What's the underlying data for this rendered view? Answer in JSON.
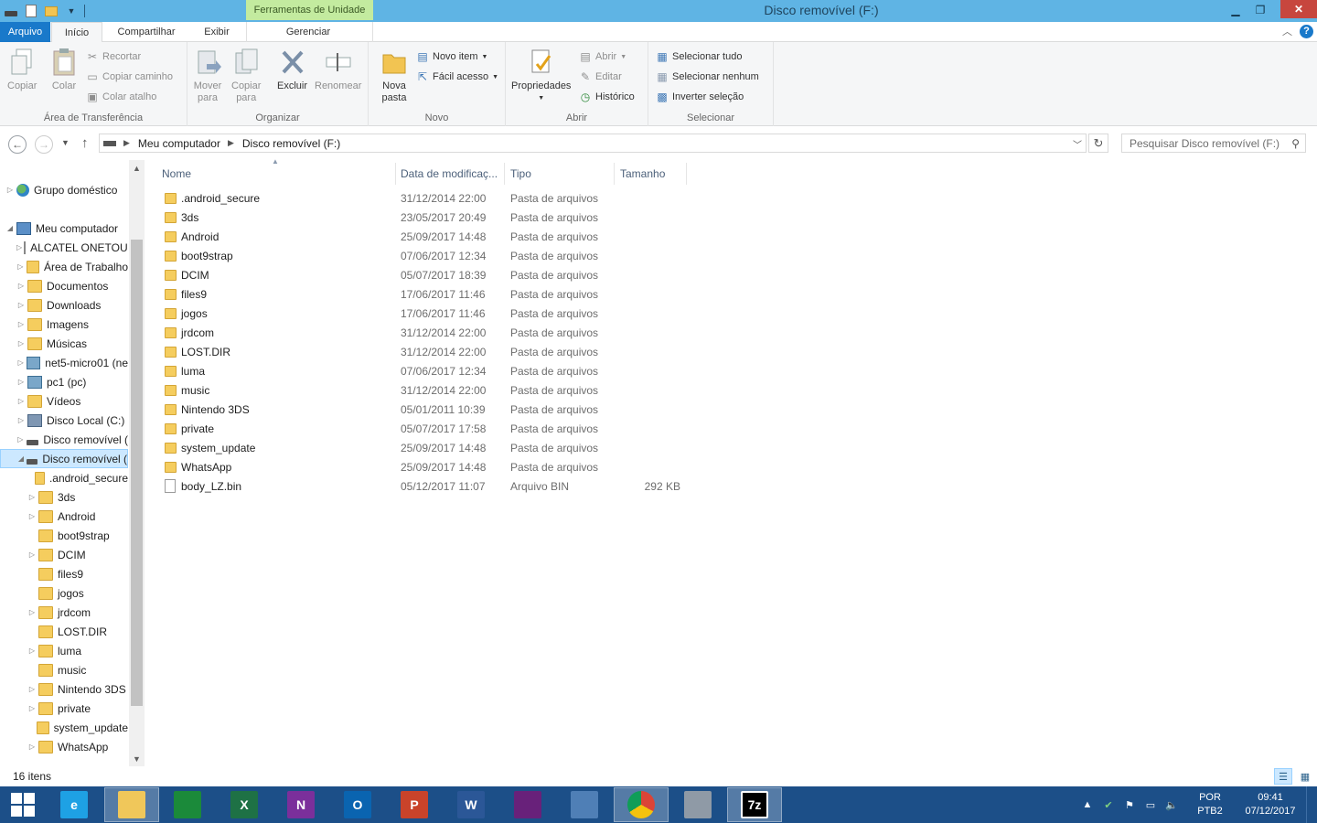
{
  "window": {
    "title": "Disco removível (F:)",
    "context_tab_header": "Ferramentas de Unidade"
  },
  "tabs": {
    "file": "Arquivo",
    "home": "Início",
    "share": "Compartilhar",
    "view": "Exibir",
    "manage": "Gerenciar"
  },
  "ribbon": {
    "clipboard": {
      "label": "Área de Transferência",
      "copy": "Copiar",
      "paste": "Colar",
      "cut": "Recortar",
      "copy_path": "Copiar caminho",
      "paste_shortcut": "Colar atalho"
    },
    "organize": {
      "label": "Organizar",
      "move_to_1": "Mover",
      "move_to_2": "para",
      "copy_to_1": "Copiar",
      "copy_to_2": "para",
      "delete": "Excluir",
      "rename": "Renomear"
    },
    "new": {
      "label": "Novo",
      "new_folder_1": "Nova",
      "new_folder_2": "pasta",
      "new_item": "Novo item",
      "easy_access": "Fácil acesso"
    },
    "open": {
      "label": "Abrir",
      "properties": "Propriedades",
      "open": "Abrir",
      "edit": "Editar",
      "history": "Histórico"
    },
    "select": {
      "label": "Selecionar",
      "select_all": "Selecionar tudo",
      "select_none": "Selecionar nenhum",
      "invert": "Inverter seleção"
    }
  },
  "address": {
    "crumbs": [
      "Meu computador",
      "Disco removível (F:)"
    ],
    "search_placeholder": "Pesquisar Disco removível (F:)"
  },
  "nav": [
    {
      "label": "Grupo doméstico",
      "icon": "homegroup-icon",
      "indent": 0,
      "expander": "▷"
    },
    {
      "label": "Meu computador",
      "icon": "computer-icon",
      "indent": 0,
      "expander": "◢"
    },
    {
      "label": "ALCATEL ONETOUCH",
      "icon": "phone-icon",
      "indent": 1,
      "expander": "▷"
    },
    {
      "label": "Área de Trabalho",
      "icon": "folder-icon",
      "indent": 1,
      "expander": "▷"
    },
    {
      "label": "Documentos",
      "icon": "folder-icon",
      "indent": 1,
      "expander": "▷"
    },
    {
      "label": "Downloads",
      "icon": "folder-icon",
      "indent": 1,
      "expander": "▷"
    },
    {
      "label": "Imagens",
      "icon": "folder-icon",
      "indent": 1,
      "expander": "▷"
    },
    {
      "label": "Músicas",
      "icon": "folder-icon",
      "indent": 1,
      "expander": "▷"
    },
    {
      "label": "net5-micro01 (ne",
      "icon": "network-icon",
      "indent": 1,
      "expander": "▷"
    },
    {
      "label": "pc1 (pc)",
      "icon": "network-icon",
      "indent": 1,
      "expander": "▷"
    },
    {
      "label": "Vídeos",
      "icon": "folder-icon",
      "indent": 1,
      "expander": "▷"
    },
    {
      "label": "Disco Local (C:)",
      "icon": "disk-icon",
      "indent": 1,
      "expander": "▷"
    },
    {
      "label": "Disco removível (",
      "icon": "drive-icon",
      "indent": 1,
      "expander": "▷"
    },
    {
      "label": "Disco removível (",
      "icon": "drive-icon",
      "indent": 1,
      "expander": "◢",
      "selected": true
    },
    {
      "label": ".android_secure",
      "icon": "folder-icon",
      "indent": 2,
      "expander": ""
    },
    {
      "label": "3ds",
      "icon": "folder-icon",
      "indent": 2,
      "expander": "▷"
    },
    {
      "label": "Android",
      "icon": "folder-icon",
      "indent": 2,
      "expander": "▷"
    },
    {
      "label": "boot9strap",
      "icon": "folder-icon",
      "indent": 2,
      "expander": ""
    },
    {
      "label": "DCIM",
      "icon": "folder-icon",
      "indent": 2,
      "expander": "▷"
    },
    {
      "label": "files9",
      "icon": "folder-icon",
      "indent": 2,
      "expander": ""
    },
    {
      "label": "jogos",
      "icon": "folder-icon",
      "indent": 2,
      "expander": ""
    },
    {
      "label": "jrdcom",
      "icon": "folder-icon",
      "indent": 2,
      "expander": "▷"
    },
    {
      "label": "LOST.DIR",
      "icon": "folder-icon",
      "indent": 2,
      "expander": ""
    },
    {
      "label": "luma",
      "icon": "folder-icon",
      "indent": 2,
      "expander": "▷"
    },
    {
      "label": "music",
      "icon": "folder-icon",
      "indent": 2,
      "expander": ""
    },
    {
      "label": "Nintendo 3DS",
      "icon": "folder-icon",
      "indent": 2,
      "expander": "▷"
    },
    {
      "label": "private",
      "icon": "folder-icon",
      "indent": 2,
      "expander": "▷"
    },
    {
      "label": "system_update",
      "icon": "folder-icon",
      "indent": 2,
      "expander": ""
    },
    {
      "label": "WhatsApp",
      "icon": "folder-icon",
      "indent": 2,
      "expander": "▷"
    }
  ],
  "columns": {
    "name": "Nome",
    "date": "Data de modificaç...",
    "type": "Tipo",
    "size": "Tamanho"
  },
  "files": [
    {
      "name": ".android_secure",
      "date": "31/12/2014 22:00",
      "type": "Pasta de arquivos",
      "size": "",
      "icon": "folder-icon"
    },
    {
      "name": "3ds",
      "date": "23/05/2017 20:49",
      "type": "Pasta de arquivos",
      "size": "",
      "icon": "folder-icon"
    },
    {
      "name": "Android",
      "date": "25/09/2017 14:48",
      "type": "Pasta de arquivos",
      "size": "",
      "icon": "folder-icon"
    },
    {
      "name": "boot9strap",
      "date": "07/06/2017 12:34",
      "type": "Pasta de arquivos",
      "size": "",
      "icon": "folder-icon"
    },
    {
      "name": "DCIM",
      "date": "05/07/2017 18:39",
      "type": "Pasta de arquivos",
      "size": "",
      "icon": "folder-icon"
    },
    {
      "name": "files9",
      "date": "17/06/2017 11:46",
      "type": "Pasta de arquivos",
      "size": "",
      "icon": "folder-icon"
    },
    {
      "name": "jogos",
      "date": "17/06/2017 11:46",
      "type": "Pasta de arquivos",
      "size": "",
      "icon": "folder-icon"
    },
    {
      "name": "jrdcom",
      "date": "31/12/2014 22:00",
      "type": "Pasta de arquivos",
      "size": "",
      "icon": "folder-icon"
    },
    {
      "name": "LOST.DIR",
      "date": "31/12/2014 22:00",
      "type": "Pasta de arquivos",
      "size": "",
      "icon": "folder-icon"
    },
    {
      "name": "luma",
      "date": "07/06/2017 12:34",
      "type": "Pasta de arquivos",
      "size": "",
      "icon": "folder-icon"
    },
    {
      "name": "music",
      "date": "31/12/2014 22:00",
      "type": "Pasta de arquivos",
      "size": "",
      "icon": "folder-icon"
    },
    {
      "name": "Nintendo 3DS",
      "date": "05/01/2011 10:39",
      "type": "Pasta de arquivos",
      "size": "",
      "icon": "folder-icon"
    },
    {
      "name": "private",
      "date": "05/07/2017 17:58",
      "type": "Pasta de arquivos",
      "size": "",
      "icon": "folder-icon"
    },
    {
      "name": "system_update",
      "date": "25/09/2017 14:48",
      "type": "Pasta de arquivos",
      "size": "",
      "icon": "folder-icon"
    },
    {
      "name": "WhatsApp",
      "date": "25/09/2017 14:48",
      "type": "Pasta de arquivos",
      "size": "",
      "icon": "folder-icon"
    },
    {
      "name": "body_LZ.bin",
      "date": "05/12/2017 11:07",
      "type": "Arquivo BIN",
      "size": "292 KB",
      "icon": "file-icon"
    }
  ],
  "status": {
    "count": "16 itens"
  },
  "taskbar": {
    "apps": [
      {
        "name": "internet-explorer-icon",
        "label": "e",
        "color": "#1ea1e4"
      },
      {
        "name": "file-explorer-icon",
        "label": "",
        "color": "#f0c75a",
        "active": true
      },
      {
        "name": "store-icon",
        "label": "",
        "color": "#1b8a3a"
      },
      {
        "name": "excel-icon",
        "label": "X",
        "color": "#1e7145"
      },
      {
        "name": "onenote-icon",
        "label": "N",
        "color": "#7b2f9b"
      },
      {
        "name": "outlook-icon",
        "label": "O",
        "color": "#0a64b0"
      },
      {
        "name": "powerpoint-icon",
        "label": "P",
        "color": "#c9432a"
      },
      {
        "name": "word-icon",
        "label": "W",
        "color": "#2b5797"
      },
      {
        "name": "visual-studio-icon",
        "label": "",
        "color": "#68217a"
      },
      {
        "name": "teamviewer-icon",
        "label": "",
        "color": "#4f7fb6"
      },
      {
        "name": "chrome-icon",
        "label": "",
        "color": "#e8b71c",
        "active": true
      },
      {
        "name": "app-grid-icon",
        "label": "",
        "color": "#8f9aa6"
      },
      {
        "name": "7zip-icon",
        "label": "7z",
        "color": "#000000",
        "active": true
      }
    ],
    "lang_1": "POR",
    "lang_2": "PTB2",
    "time": "09:41",
    "date": "07/12/2017"
  },
  "colors": {
    "titlebar": "#5fb4e4",
    "file_tab": "#1979ca",
    "context_tab": "#c3eb9f",
    "selection": "#cce8ff",
    "taskbar": "#1c4f88"
  }
}
